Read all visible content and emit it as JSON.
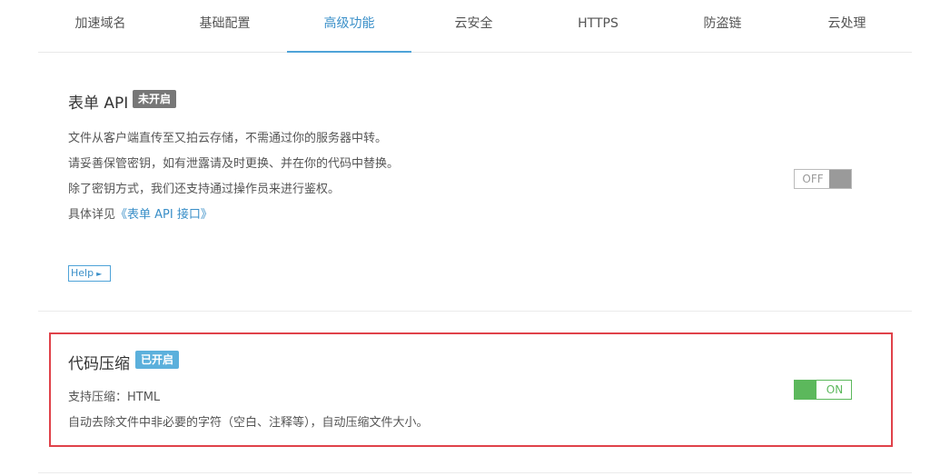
{
  "tabs": [
    {
      "label": "加速域名"
    },
    {
      "label": "基础配置"
    },
    {
      "label": "高级功能",
      "active": true
    },
    {
      "label": "云安全"
    },
    {
      "label": "HTTPS"
    },
    {
      "label": "防盗链"
    },
    {
      "label": "云处理"
    }
  ],
  "form_api": {
    "title": "表单 API",
    "badge": "未开启",
    "desc": [
      "文件从客户端直传至又拍云存储，不需通过你的服务器中转。",
      "请妥善保管密钥，如有泄露请及时更换、并在你的代码中替换。",
      "除了密钥方式，我们还支持通过操作员来进行鉴权。"
    ],
    "detail_prefix": "具体详见",
    "detail_link": "《表单 API 接口》",
    "help_label": "Help",
    "toggle_label": "OFF"
  },
  "code_compress": {
    "title": "代码压缩",
    "badge": "已开启",
    "support": "支持压缩：HTML",
    "desc": "自动去除文件中非必要的字符（空白、注释等），自动压缩文件大小。",
    "toggle_label": "ON"
  },
  "colors": {
    "accent": "#3a8fc8",
    "badge_off": "#777777",
    "badge_on": "#5bb0dc",
    "toggle_on": "#5cb85c",
    "toggle_off": "#9a9a9a",
    "highlight": "#e0424a"
  }
}
